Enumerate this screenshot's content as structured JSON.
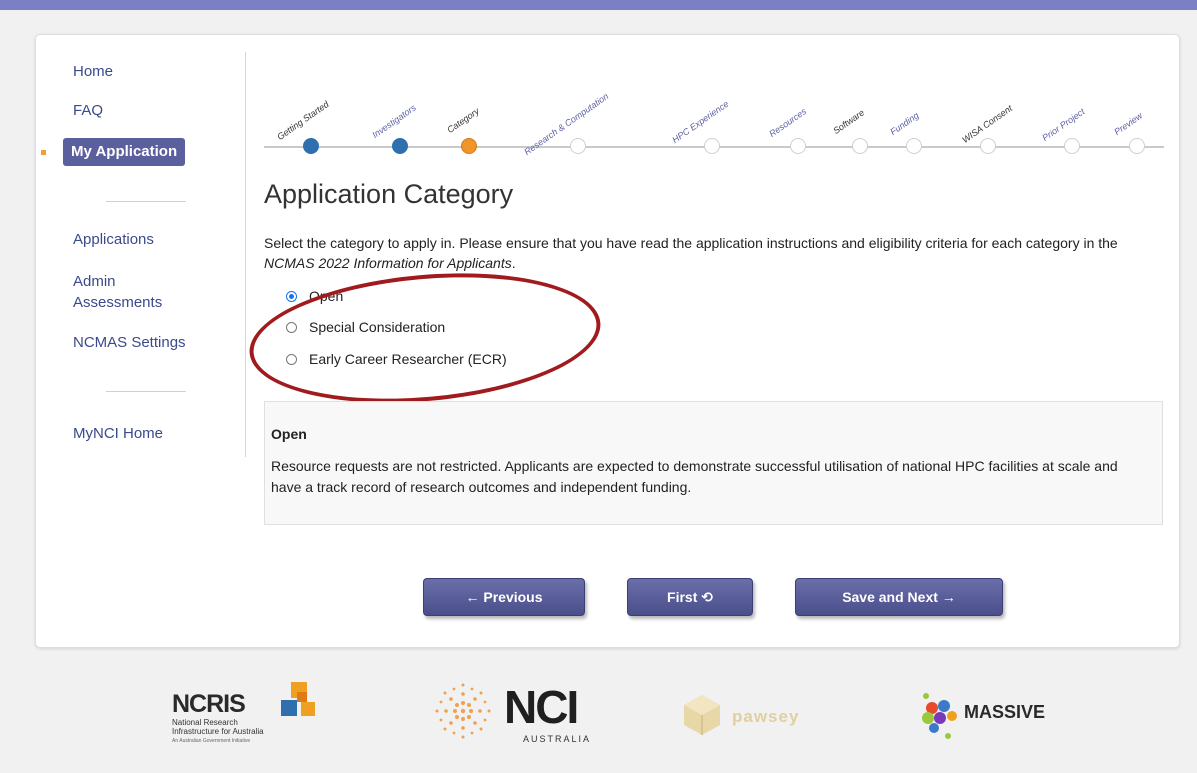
{
  "sidebar": {
    "items_top": [
      "Home",
      "FAQ",
      "My Application"
    ],
    "items_mid": [
      "Applications",
      "Admin Assessments",
      "NCMAS Settings"
    ],
    "items_bottom": [
      "MyNCI Home"
    ]
  },
  "progress": {
    "steps": [
      "Getting Started",
      "Investigators",
      "Category",
      "Research & Computation",
      "HPC Experience",
      "Resources",
      "Software",
      "Funding",
      "WISA Consent",
      "Prior Project",
      "Preview"
    ],
    "completed": 2,
    "current_index": 2
  },
  "page": {
    "title": "Application Category",
    "instructions_part1": "Select the category to apply in. Please ensure that you have read the application instructions and eligibility criteria for each category in the ",
    "instructions_em": "NCMAS 2022 Information for Applicants",
    "instructions_part2": "."
  },
  "categories": {
    "options": [
      "Open",
      "Special Consideration",
      "Early Career Researcher (ECR)"
    ],
    "selected": "Open"
  },
  "info": {
    "title": "Open",
    "text": "Resource requests are not restricted. Applicants are expected to demonstrate successful utilisation of national HPC facilities at scale and have a track record of research outcomes and independent funding."
  },
  "buttons": {
    "previous": "← Previous",
    "first": "First ⟲",
    "save_next": "Save and Next →"
  },
  "footer": {
    "ncris": "NCRIS",
    "ncris_sub1": "National Research",
    "ncris_sub2": "Infrastructure for Australia",
    "ncris_sub3": "An Australian Government Initiative",
    "nci": "NCI",
    "nci_sub": "AUSTRALIA",
    "pawsey": "pawsey",
    "massive": "MASSIVE"
  },
  "colors": {
    "accent": "#5b5fa6",
    "step_done": "#2f6fae",
    "step_current": "#f0952c",
    "highlight": "#a01a1e"
  }
}
